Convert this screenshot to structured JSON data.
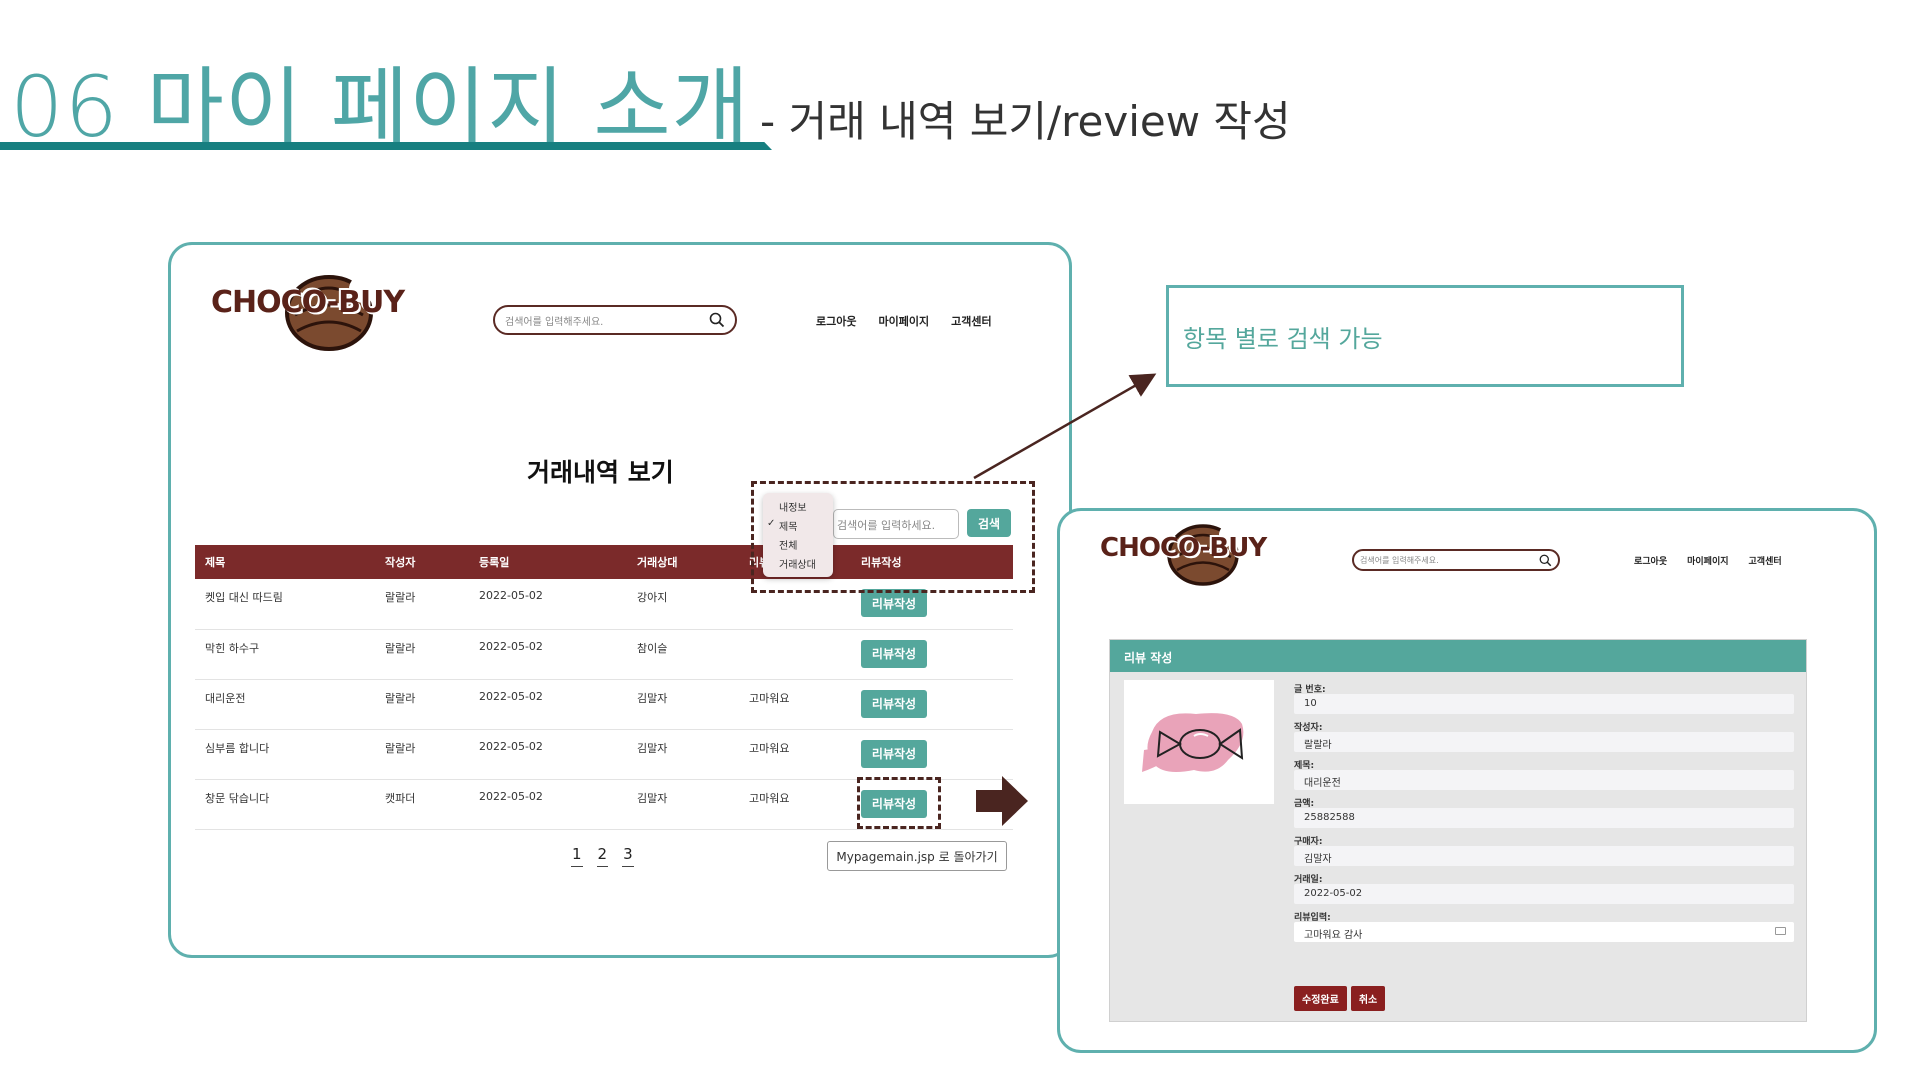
{
  "slide": {
    "title": "06 마이 페이지 소개",
    "subtitle": "- 거래 내역 보기/review 작성",
    "callout": "항목 별로 검색 가능"
  },
  "site": {
    "logo": "CHOCO-BUY",
    "search_placeholder": "검색어를 입력해주세요.",
    "nav": [
      "로그아웃",
      "마이페이지",
      "고객센터"
    ]
  },
  "history": {
    "title": "거래내역 보기",
    "filter_options": [
      "내정보",
      "제목",
      "전체",
      "거래상대"
    ],
    "filter_selected": "제목",
    "search_placeholder": "검색어를 입력하세요.",
    "search_button": "검색",
    "columns": [
      "제목",
      "작성자",
      "등록일",
      "거래상대",
      "리뷰",
      "리뷰작성"
    ],
    "rows": [
      {
        "title": "켓입 대신 따드림",
        "author": "랄랄라",
        "date": "2022-05-02",
        "partner": "강아지",
        "review": "",
        "action": "리뷰작성"
      },
      {
        "title": "막힌 하수구",
        "author": "랄랄라",
        "date": "2022-05-02",
        "partner": "참이슬",
        "review": "",
        "action": "리뷰작성"
      },
      {
        "title": "대리운전",
        "author": "랄랄라",
        "date": "2022-05-02",
        "partner": "김말자",
        "review": "고마워요",
        "action": "리뷰작성"
      },
      {
        "title": "심부름 합니다",
        "author": "랄랄라",
        "date": "2022-05-02",
        "partner": "김말자",
        "review": "고마워요",
        "action": "리뷰작성"
      },
      {
        "title": "창문 닦습니다",
        "author": "캣파더",
        "date": "2022-05-02",
        "partner": "김말자",
        "review": "고마워요",
        "action": "리뷰작성"
      }
    ],
    "pages": [
      "1",
      "2",
      "3"
    ],
    "back_button": "Mypagemain.jsp 로 돌아가기"
  },
  "review_form": {
    "header": "리뷰 작성",
    "fields": [
      {
        "label": "글 번호:",
        "value": "10"
      },
      {
        "label": "작성자:",
        "value": "랄랄라"
      },
      {
        "label": "제목:",
        "value": "대리운전"
      },
      {
        "label": "금액:",
        "value": "25882588"
      },
      {
        "label": "구매자:",
        "value": "김말자"
      },
      {
        "label": "거래일:",
        "value": "2022-05-02"
      },
      {
        "label": "리뷰입력:",
        "value": "고마워요  감사"
      }
    ],
    "submit_button": "수정완료",
    "cancel_button": "취소"
  },
  "colors": {
    "teal": "#54a79c",
    "frame": "#5fb0ae",
    "maroon": "#7b2a2a",
    "brown": "#5a2219"
  }
}
